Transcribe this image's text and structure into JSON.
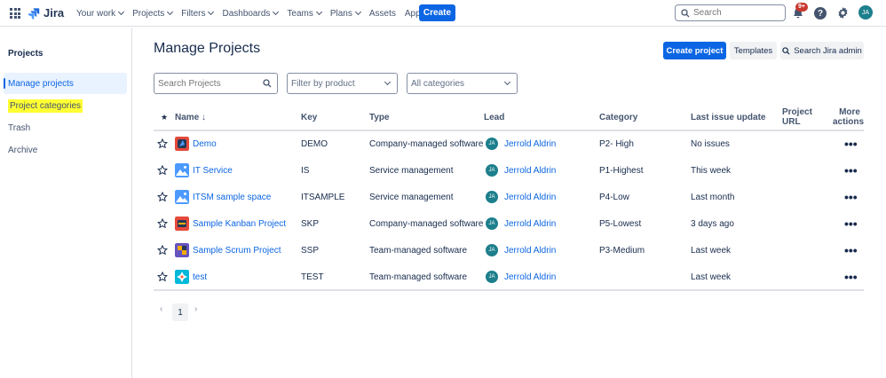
{
  "topnav": {
    "logo_text": "Jira",
    "items": [
      "Your work",
      "Projects",
      "Filters",
      "Dashboards",
      "Teams",
      "Plans",
      "Assets",
      "Apps"
    ],
    "create_label": "Create",
    "search_placeholder": "Search",
    "notification_badge": "9+",
    "help_label": "?",
    "user_initials": "JA"
  },
  "sidebar": {
    "title": "Projects",
    "items": [
      "Manage projects",
      "Project categories",
      "Trash",
      "Archive"
    ]
  },
  "page": {
    "title": "Manage Projects",
    "create_project_label": "Create project",
    "templates_label": "Templates",
    "search_admin_label": "Search Jira admin"
  },
  "filters": {
    "search_placeholder": "Search Projects",
    "product_label": "Filter by product",
    "category_label": "All categories"
  },
  "table": {
    "headers": {
      "name": "Name",
      "key": "Key",
      "type": "Type",
      "lead": "Lead",
      "category": "Category",
      "last_update": "Last issue update",
      "url_line1": "Project",
      "url_line2": "URL",
      "actions_line1": "More",
      "actions_line2": "actions"
    },
    "rows": [
      {
        "name": "Demo",
        "key": "DEMO",
        "type": "Company-managed software",
        "lead_initials": "JA",
        "lead": "Jerrold Aldrin",
        "category": "P2- High",
        "last_update": "No issues",
        "actions": "•••"
      },
      {
        "name": "IT Service",
        "key": "IS",
        "type": "Service management",
        "lead_initials": "JA",
        "lead": "Jerrold Aldrin",
        "category": "P1-Highest",
        "last_update": "This week",
        "actions": "•••"
      },
      {
        "name": "ITSM sample space",
        "key": "ITSAMPLE",
        "type": "Service management",
        "lead_initials": "JA",
        "lead": "Jerrold Aldrin",
        "category": "P4-Low",
        "last_update": "Last month",
        "actions": "•••"
      },
      {
        "name": "Sample Kanban Project",
        "key": "SKP",
        "type": "Company-managed software",
        "lead_initials": "JA",
        "lead": "Jerrold Aldrin",
        "category": "P5-Lowest",
        "last_update": "3 days ago",
        "actions": "•••"
      },
      {
        "name": "Sample Scrum Project",
        "key": "SSP",
        "type": "Team-managed software",
        "lead_initials": "JA",
        "lead": "Jerrold Aldrin",
        "category": "P3-Medium",
        "last_update": "Last week",
        "actions": "•••"
      },
      {
        "name": "test",
        "key": "TEST",
        "type": "Team-managed software",
        "lead_initials": "JA",
        "lead": "Jerrold Aldrin",
        "category": "",
        "last_update": "Last week",
        "actions": "•••"
      }
    ]
  },
  "pagination": {
    "current_page": "1"
  },
  "colors": {
    "primary": "#0C66E4",
    "highlight": "#FFFF33",
    "avatar": "#1D7F8C"
  }
}
